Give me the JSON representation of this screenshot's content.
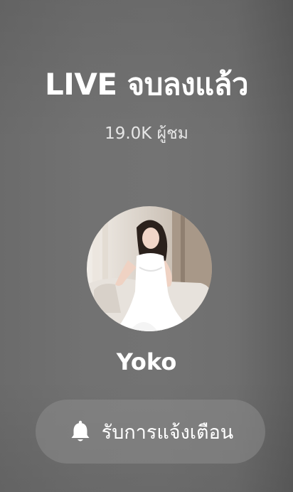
{
  "end_screen": {
    "title": "LIVE จบลงแล้ว",
    "viewers": "19.0K ผู้ชม",
    "host": {
      "name": "Yoko"
    },
    "notify_button": {
      "label": "รับการแจ้งเตือน",
      "icon": "bell-icon"
    }
  }
}
